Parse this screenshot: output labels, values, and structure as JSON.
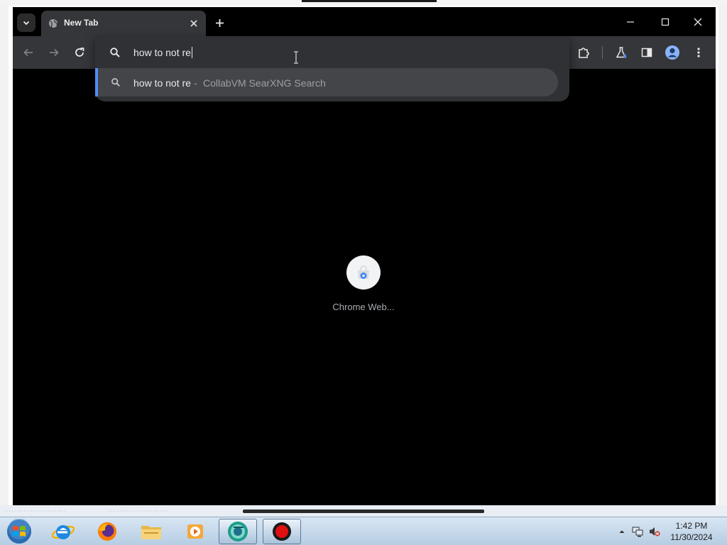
{
  "browser": {
    "tab": {
      "title": "New Tab",
      "favicon": "globe-icon",
      "close_icon": "close-icon"
    },
    "new_tab_icon": "plus-icon",
    "tab_search_icon": "chevron-down-icon",
    "window_controls": [
      "minimize-icon",
      "maximize-icon",
      "close-icon"
    ],
    "toolbar": {
      "back_icon": "arrow-left-icon",
      "forward_icon": "arrow-right-icon",
      "reload_icon": "reload-icon",
      "right_icons": [
        "puzzle-extensions-icon",
        "flask-labs-icon",
        "side-panel-icon",
        "profile-avatar-icon",
        "kebab-menu-icon"
      ]
    },
    "omnibox": {
      "value": "how to not re",
      "suggestion": {
        "query": "how to not re",
        "separator": "-",
        "provider": "CollabVM SearXNG Search"
      }
    },
    "ntp": {
      "shortcut_label": "Chrome Web..."
    },
    "colors": {
      "tab_strip": "#000000",
      "toolbar": "#35363a",
      "omnibox_popup": "#303134",
      "suggestion_selected": "#444549",
      "accent": "#4c8df6",
      "content_bg": "#000000"
    }
  },
  "taskbar": {
    "apps": [
      "internet-explorer-icon",
      "firefox-icon",
      "file-explorer-icon",
      "media-player-icon",
      "chrome-app-icon",
      "record-icon"
    ],
    "tray_icons": [
      "show-hidden-icons-icon",
      "network-icon",
      "volume-muted-icon"
    ],
    "clock": {
      "time": "1:42 PM",
      "date": "11/30/2024"
    }
  }
}
